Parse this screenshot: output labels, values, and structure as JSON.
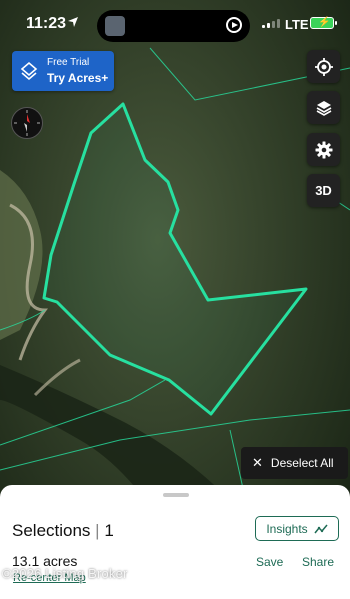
{
  "status_bar": {
    "time": "11:23",
    "carrier": "LTE"
  },
  "trial": {
    "line1": "Free Trial",
    "line2": "Try Acres+"
  },
  "map_controls": {
    "three_d": "3D"
  },
  "deselect": {
    "label": "Deselect All"
  },
  "sheet": {
    "title": "Selections",
    "divider": "|",
    "count": "1",
    "insights": "Insights",
    "acres": "13.1 acres",
    "save": "Save",
    "share": "Share",
    "recenter": "Re-center Map"
  },
  "watermark": "©2026 Listing Broker",
  "colors": {
    "parcel_outline": "#27e0a0",
    "accent": "#1e6b55",
    "trial_bg": "#1e64c8"
  }
}
